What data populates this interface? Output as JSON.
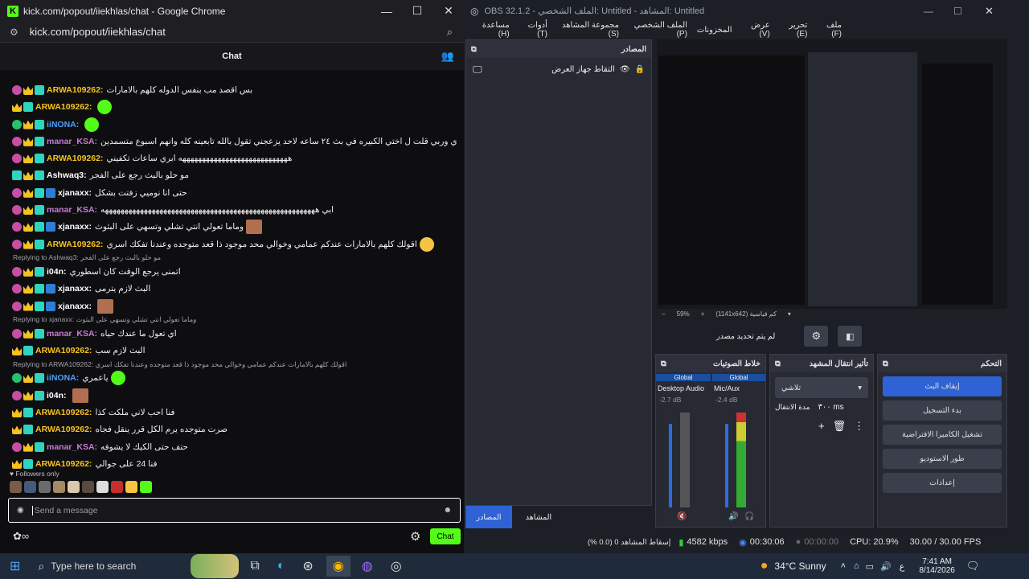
{
  "chrome": {
    "title": "kick.com/popout/iiekhlas/chat - Google Chrome",
    "url": "kick.com/popout/iiekhlas/chat"
  },
  "chat": {
    "header": "Chat",
    "followers_label": "Followers only",
    "input_placeholder": "Send a message",
    "send_label": "Chat",
    "messages": [
      {
        "user": "",
        "text": "",
        "reply": ""
      },
      {
        "user": "ARWA109262:",
        "color": "#f6c21f",
        "text": "بس اقصد مب بنفس الدوله كلهم بالامارات",
        "badges": [
          "pink",
          "crown",
          "tq"
        ]
      },
      {
        "user": "ARWA109262:",
        "color": "#f6c21f",
        "text": "",
        "badges": [
          "crown",
          "tq"
        ],
        "emote": "green"
      },
      {
        "user": "iiNONA:",
        "color": "#4aa0ff",
        "text": "",
        "badges": [
          "green",
          "crown",
          "tq"
        ],
        "emote": "green"
      },
      {
        "user": "manar_KSA:",
        "color": "#c87bd8",
        "text": "اي وربي قلت ل اختي الكبيره في بث ٢٤ ساعه لاحد يزعجني تقول بالله تابعينه كله وانهم اسبوع متسمدين",
        "badges": [
          "pink",
          "crown",
          "tq"
        ],
        "emote": "face"
      },
      {
        "user": "ARWA109262:",
        "color": "#f6c21f",
        "text": "ههههههههههههههههههههههههههههه ابري ساعات تكفيني",
        "badges": [
          "pink",
          "crown",
          "tq"
        ]
      },
      {
        "user": "Ashwaq3:",
        "color": "#ffffff",
        "text": "مو حلو بالبث رجع على الفجر",
        "badges": [
          "tq",
          "crown",
          "tq"
        ]
      },
      {
        "user": "xjanaxx:",
        "color": "#ffffff",
        "text": "حتى انا نوميي زفتت بشكل",
        "badges": [
          "pink",
          "crown",
          "tq",
          "blue"
        ]
      },
      {
        "user": "manar_KSA:",
        "color": "#c87bd8",
        "text": "ابي هههههههههههههههههههههههههههههههههههههههههههههههههههههههه",
        "badges": [
          "pink",
          "crown",
          "tq"
        ]
      },
      {
        "user": "xjanaxx:",
        "color": "#ffffff",
        "text": "وماما تعولي انتي تشلي وتسهي على البثوث",
        "badges": [
          "pink",
          "crown",
          "tq",
          "blue"
        ],
        "emote": "face"
      },
      {
        "user": "ARWA109262:",
        "color": "#f6c21f",
        "text": "اقولك كلهم بالامارات عندكم عمامي وخوالي محد موجود ذا قعد متوجده وعندنا تفكك اسري",
        "badges": [
          "pink",
          "crown",
          "tq"
        ],
        "emote": "y"
      },
      {
        "reply": "Replying to Ashwaq3: مو حلو بالبث رجع على الفجر"
      },
      {
        "user": "i04n:",
        "color": "#ffffff",
        "text": "اتمنى يرجع الوقت كان اسطوري",
        "badges": [
          "pink",
          "crown",
          "tq"
        ]
      },
      {
        "user": "xjanaxx:",
        "color": "#ffffff",
        "text": "البث لازم يترمى",
        "badges": [
          "pink",
          "crown",
          "tq",
          "blue"
        ]
      },
      {
        "user": "xjanaxx:",
        "color": "#ffffff",
        "text": "",
        "badges": [
          "pink",
          "crown",
          "tq",
          "blue"
        ],
        "emote": "face"
      },
      {
        "reply": "Replying to xjanaxx: وماما تعولي انتي تشلي وتسهي على البثوث"
      },
      {
        "user": "manar_KSA:",
        "color": "#c87bd8",
        "text": "اي تعول ما عندك حياه",
        "badges": [
          "pink",
          "crown",
          "tq"
        ]
      },
      {
        "user": "ARWA109262:",
        "color": "#f6c21f",
        "text": "البث لازم سب",
        "badges": [
          "crown",
          "tq"
        ]
      },
      {
        "reply": "Replying to ARWA109262: اقولك كلهم بالامارات عندكم عمامي وخوالي محد موجود ذا قعد متوجده وعندنا تفكك اسري"
      },
      {
        "user": "iiNONA:",
        "color": "#4aa0ff",
        "text": "ياعمري",
        "badges": [
          "green",
          "crown",
          "tq"
        ],
        "emote": "green"
      },
      {
        "user": "i04n:",
        "color": "#ffffff",
        "text": "",
        "badges": [
          "pink",
          "crown",
          "tq"
        ],
        "emote": "face"
      },
      {
        "user": "ARWA109262:",
        "color": "#f6c21f",
        "text": "فنا احب لاني ملكت كذا",
        "badges": [
          "crown",
          "tq"
        ]
      },
      {
        "user": "ARWA109262:",
        "color": "#f6c21f",
        "text": "صرت متوجده يرم الكل قرر ينقل فجاه",
        "badges": [
          "crown",
          "tq"
        ]
      },
      {
        "user": "manar_KSA:",
        "color": "#c87bd8",
        "text": "حتف حتى الكيك لا يشوفه",
        "badges": [
          "pink",
          "crown",
          "tq"
        ]
      },
      {
        "user": "ARWA109262:",
        "color": "#f6c21f",
        "text": "فنا 24 على جوالي",
        "badges": [
          "crown",
          "tq"
        ]
      }
    ]
  },
  "obs": {
    "title": "OBS 32.1.2 - الملف الشخصي: Untitled - المشاهد: Untitled",
    "menu": [
      "ملف (F)",
      "تحرير (E)",
      "عرض (V)",
      "المخزونات",
      "الملف الشخصي (P)",
      "مجموعة المشاهد (S)",
      "أدوات (T)",
      "مساعدة (H)"
    ],
    "sources_title": "المصادر",
    "source_item": "التقاط جهاز العرض",
    "no_source": "لم يتم تحديد مصدر",
    "mixer_title": "خلاط الصوتيات",
    "transition_title": "تأثير انتقال المشهد",
    "controls_title": "التحكم",
    "ch1": {
      "tag": "Global",
      "name": "Desktop Audio",
      "db": "-2.7 dB"
    },
    "ch2": {
      "tag": "Global",
      "name": "Mic/Aux",
      "db": "-2.4 dB"
    },
    "transition_value": "تلاشي",
    "duration_label": "مدة الانتقال",
    "duration_value": "٣٠٠ ms",
    "controls": [
      "إيقاف البث",
      "بدء التسجيل",
      "تشغيل الكاميرا الافتراضية",
      "طور الاستوديو",
      "إعدادات"
    ],
    "tab_sources": "المصادر",
    "tab_scenes": "المشاهد",
    "zoom": "59%",
    "resolution": "(1141x642) كم قياسية",
    "status": {
      "dropped": "إسقاط المشاهد 0 (0.0 %)",
      "bitrate": "4582 kbps",
      "live": "00:30:06",
      "rec": "00:00:00",
      "cpu": "CPU: 20.9%",
      "fps": "30.00 / 30.00 FPS"
    }
  },
  "taskbar": {
    "search": "Type here to search",
    "weather": "34°C  Sunny",
    "time": "7:41 AM",
    "date": "8/14/2026",
    "lang": "ع"
  }
}
